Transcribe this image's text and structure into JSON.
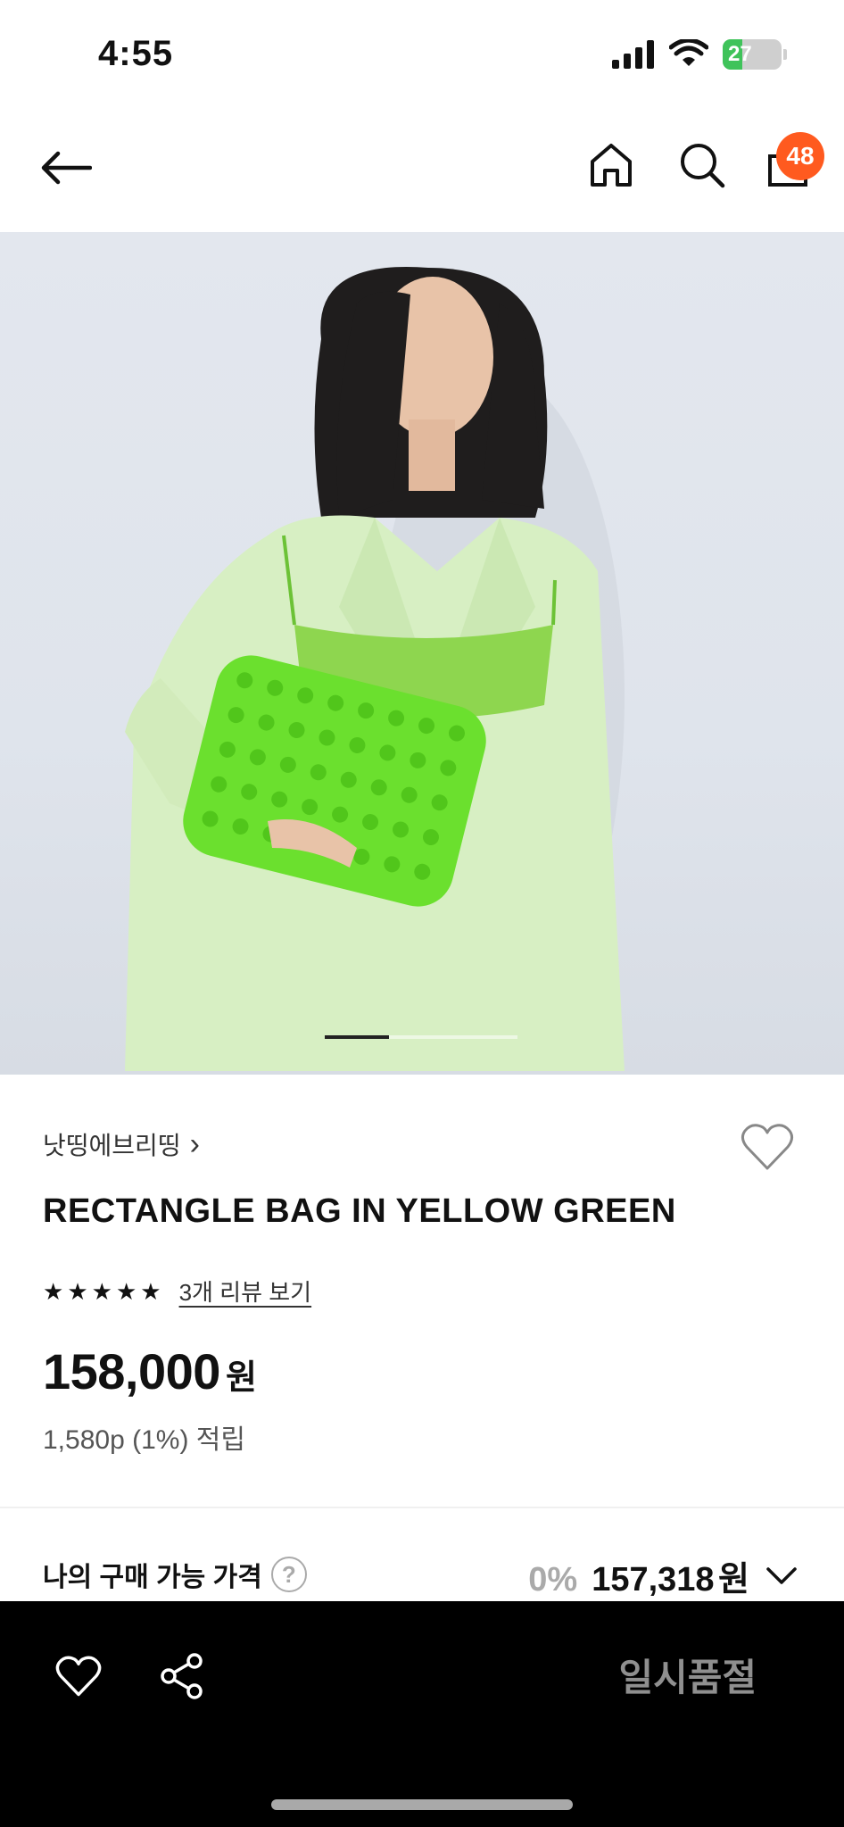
{
  "status_bar": {
    "time": "4:55",
    "battery": "27",
    "icons": [
      "signal-icon",
      "wifi-icon",
      "battery-icon"
    ]
  },
  "nav": {
    "icons": [
      "back-arrow-icon",
      "home-icon",
      "search-icon",
      "shopping-bag-icon"
    ],
    "cart_count": "48",
    "badge_color": "#ff5a1f"
  },
  "product": {
    "image_alt_icon": "product-photo",
    "carousel_position": "1/3",
    "brand": "낫띵에브리띵",
    "brand_chevron": "›",
    "title": "RECTANGLE BAG IN YELLOW GREEN",
    "rating_stars": 5,
    "review_link": "3개 리뷰 보기",
    "price": "158,000",
    "price_unit": "원",
    "points": "1,580p (1%) 적립"
  },
  "my_price": {
    "label": "나의 구매 가능 가격",
    "help": "?",
    "discount": "0%",
    "price": "157,318",
    "unit": "원"
  },
  "bottom_bar": {
    "status": "일시품절",
    "icons": [
      "heart-outline-icon",
      "share-icon"
    ]
  },
  "colors": {
    "accent": "#ff5a1f",
    "bottom_bar": "#000000",
    "soldout_text": "#8f8f8f"
  }
}
